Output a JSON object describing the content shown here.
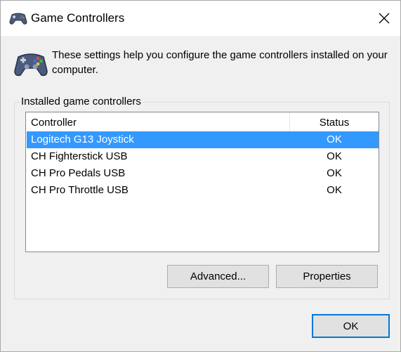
{
  "window": {
    "title": "Game Controllers",
    "title_icon": "gamepad-icon",
    "close_icon": "close-icon"
  },
  "header": {
    "icon": "gamepad-icon",
    "description": "These settings help you configure the game controllers installed on your computer."
  },
  "installed": {
    "group_label": "Installed game controllers",
    "columns": {
      "controller": "Controller",
      "status": "Status"
    },
    "rows": [
      {
        "name": "Logitech G13 Joystick",
        "status": "OK",
        "selected": true
      },
      {
        "name": "CH Fighterstick USB",
        "status": "OK",
        "selected": false
      },
      {
        "name": "CH Pro Pedals USB",
        "status": "OK",
        "selected": false
      },
      {
        "name": "CH Pro Throttle USB",
        "status": "OK",
        "selected": false
      }
    ]
  },
  "buttons": {
    "advanced": "Advanced...",
    "properties": "Properties",
    "ok": "OK"
  },
  "colors": {
    "selection": "#3399ff",
    "default_button_border": "#0078d7"
  }
}
